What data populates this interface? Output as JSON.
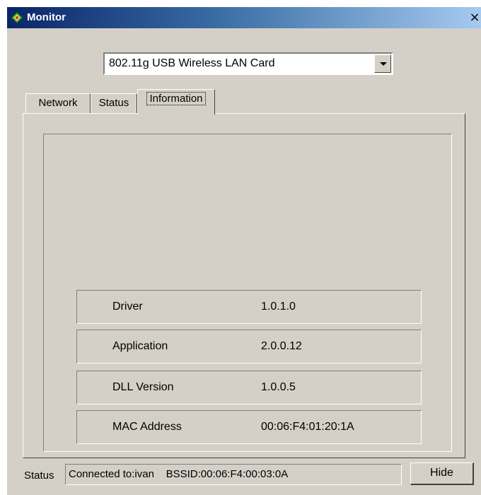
{
  "window": {
    "title": "Monitor",
    "close_glyph": "×"
  },
  "adapter": {
    "selected": "802.11g USB Wireless LAN Card"
  },
  "tabs": [
    {
      "label": "Network",
      "active": false
    },
    {
      "label": "Status",
      "active": false
    },
    {
      "label": "Information",
      "active": true
    }
  ],
  "information": {
    "rows": [
      {
        "label": "Driver",
        "value": "1.0.1.0"
      },
      {
        "label": "Application",
        "value": "2.0.0.12"
      },
      {
        "label": "DLL Version",
        "value": "1.0.0.5"
      },
      {
        "label": "MAC Address",
        "value": "00:06:F4:01:20:1A"
      }
    ]
  },
  "statusbar": {
    "label": "Status",
    "text": "Connected to:ivan    BSSID:00:06:F4:00:03:0A"
  },
  "buttons": {
    "hide_label": "Hide"
  },
  "icons": {
    "title": "wireless-monitor-icon",
    "close": "close-icon",
    "dropdown": "chevron-down-icon"
  },
  "colors": {
    "titlebar_start": "#0a246a",
    "titlebar_end": "#a6caf0",
    "face": "#d4d0c8"
  }
}
